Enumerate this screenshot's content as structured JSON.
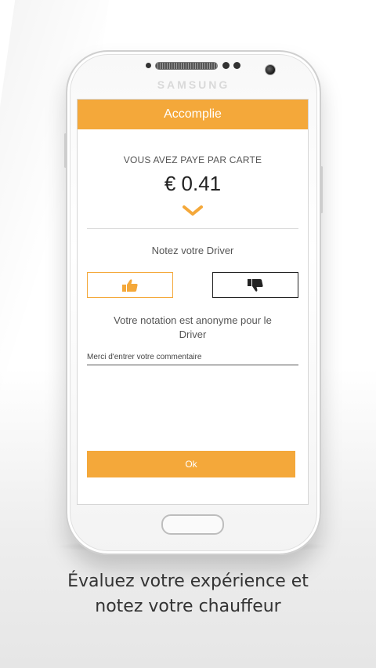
{
  "device": {
    "brand": "SAMSUNG"
  },
  "app": {
    "title": "Accomplie",
    "payment_label": "VOUS AVEZ PAYE PAR CARTE",
    "amount": "€ 0.41",
    "rate_prompt": "Notez votre Driver",
    "anonymous_note": "Votre notation est anonyme pour le Driver",
    "comment_placeholder": "Merci d'entrer votre commentaire",
    "ok_label": "Ok",
    "accent_color": "#f4a83a"
  },
  "caption": {
    "line1": "Évaluez votre expérience et",
    "line2": "notez votre chauffeur"
  }
}
